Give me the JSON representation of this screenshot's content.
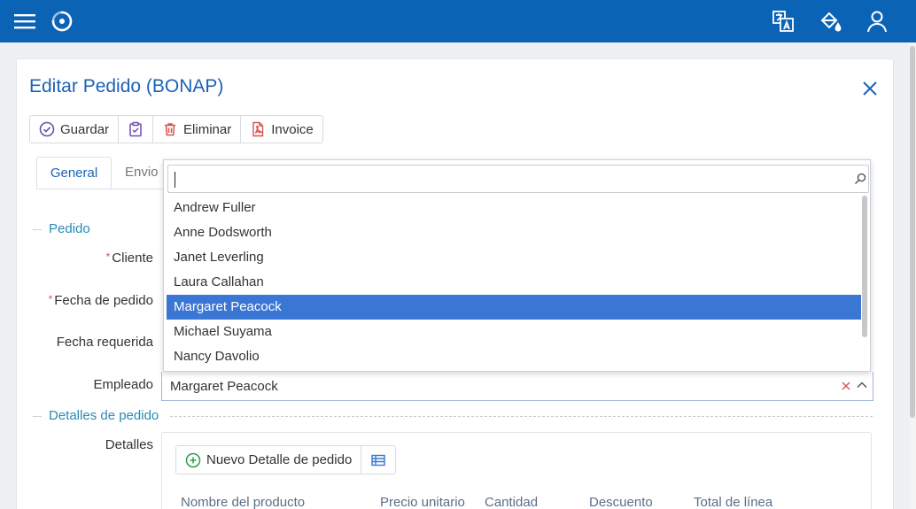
{
  "topbar": {
    "menu_icon": "hamburger-icon",
    "logo_icon": "swirl-logo-icon",
    "right_icons": [
      "translate-icon",
      "paint-bucket-icon",
      "user-icon"
    ]
  },
  "dialog": {
    "title": "Editar Pedido (BONAP)",
    "toolbar": {
      "save_label": "Guardar",
      "delete_label": "Eliminar",
      "invoice_label": "Invoice"
    },
    "tabs": [
      "General",
      "Envio"
    ],
    "sections": {
      "pedido": "Pedido",
      "detalles": "Detalles de pedido"
    },
    "fields": {
      "cliente": "Cliente",
      "fecha_pedido": "Fecha de pedido",
      "fecha_requerida": "Fecha requerida",
      "empleado": "Empleado",
      "detalles": "Detalles"
    },
    "required_mark": "*"
  },
  "employee_combo": {
    "value": "Margaret Peacock",
    "search_value": "",
    "options": [
      "Andrew Fuller",
      "Anne Dodsworth",
      "Janet Leverling",
      "Laura Callahan",
      "Margaret Peacock",
      "Michael Suyama",
      "Nancy Davolio"
    ],
    "selected_index": 4
  },
  "details_grid": {
    "new_label": "Nuevo Detalle de pedido",
    "columns": [
      "Nombre del producto",
      "Precio unitario",
      "Cantidad",
      "Descuento",
      "Total de línea"
    ]
  },
  "colors": {
    "topbar": "#0b63b6",
    "title": "#1d62b5",
    "section": "#2a8ab8",
    "selected_option": "#3a76d4",
    "delete": "#d9534f"
  }
}
